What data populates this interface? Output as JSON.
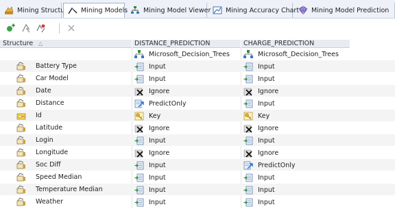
{
  "tabs": [
    {
      "label": "Mining Structure",
      "icon": "mining-structure-icon",
      "active": false
    },
    {
      "label": "Mining Models",
      "icon": "mining-models-icon",
      "active": true
    },
    {
      "label": "Mining Model Viewer",
      "icon": "model-viewer-icon",
      "active": false
    },
    {
      "label": "Mining Accuracy Chart",
      "icon": "accuracy-chart-icon",
      "active": false
    },
    {
      "label": "Mining Model Prediction",
      "icon": "model-prediction-icon",
      "active": false
    }
  ],
  "toolbar": {
    "icons": [
      "create-model-icon",
      "process-icon",
      "process-all-icon",
      "delete-icon"
    ]
  },
  "table": {
    "structure_header": "Structure",
    "sort_glyph": "△",
    "columns": [
      {
        "name": "DISTANCE_PREDICTION",
        "algorithm": "Microsoft_Decision_Trees"
      },
      {
        "name": "CHARGE_PREDICTION",
        "algorithm": "Microsoft_Decision_Trees"
      }
    ],
    "rows": [
      {
        "name": "Battery Type",
        "key": false,
        "usage": [
          "Input",
          "Input"
        ]
      },
      {
        "name": "Car Model",
        "key": false,
        "usage": [
          "Input",
          "Input"
        ]
      },
      {
        "name": "Date",
        "key": false,
        "usage": [
          "Ignore",
          "Ignore"
        ]
      },
      {
        "name": "Distance",
        "key": false,
        "usage": [
          "PredictOnly",
          "Input"
        ]
      },
      {
        "name": "Id",
        "key": true,
        "usage": [
          "Key",
          "Key"
        ]
      },
      {
        "name": "Latitude",
        "key": false,
        "usage": [
          "Ignore",
          "Ignore"
        ]
      },
      {
        "name": "Login",
        "key": false,
        "usage": [
          "Input",
          "Input"
        ]
      },
      {
        "name": "Longitude",
        "key": false,
        "usage": [
          "Ignore",
          "Ignore"
        ]
      },
      {
        "name": "Soc Diff",
        "key": false,
        "usage": [
          "Input",
          "PredictOnly"
        ]
      },
      {
        "name": "Speed Median",
        "key": false,
        "usage": [
          "Input",
          "Input"
        ]
      },
      {
        "name": "Temperature Median",
        "key": false,
        "usage": [
          "Input",
          "Input"
        ]
      },
      {
        "name": "Weather",
        "key": false,
        "usage": [
          "Input",
          "Input"
        ]
      }
    ]
  },
  "colors": {
    "accent": "#3a78c2",
    "predict": "#1f6fd6",
    "ignore_x": "#111111",
    "key_gold": "#e2b21c"
  }
}
